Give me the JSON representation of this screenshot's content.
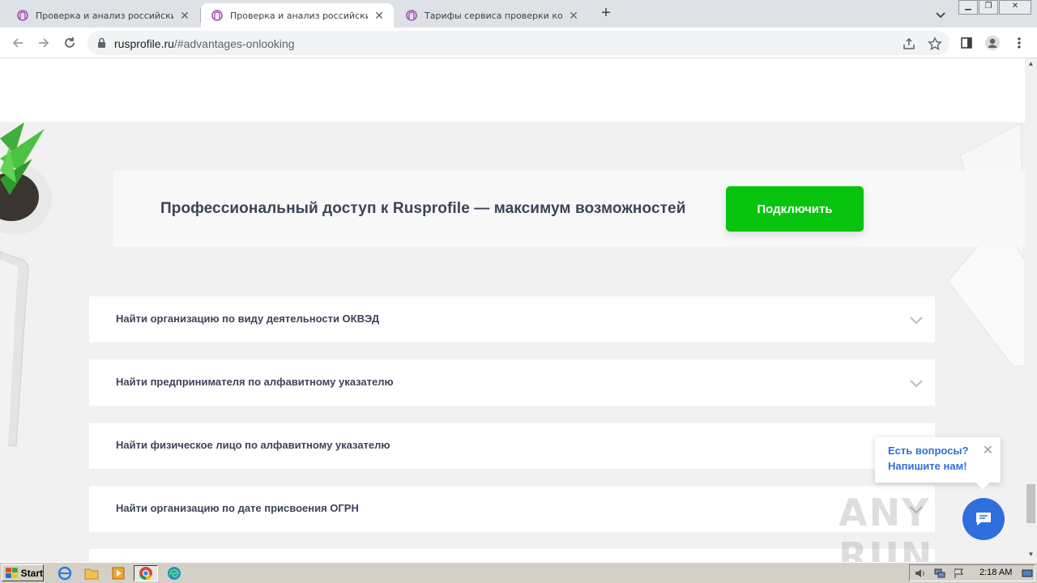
{
  "browser": {
    "tabs": [
      {
        "title": "Проверка и анализ российских юр",
        "active": false
      },
      {
        "title": "Проверка и анализ российских юр",
        "active": true
      },
      {
        "title": "Тарифы сервиса проверки контра",
        "active": false
      }
    ],
    "new_tab_label": "+",
    "address": {
      "host": "rusprofile.ru",
      "path": "/#advantages-onlooking"
    }
  },
  "page": {
    "promo_text": "Профессиональный доступ к Rusprofile — максимум возможностей",
    "connect_label": "Подключить",
    "accordion": [
      {
        "label": "Найти организацию по виду деятельности ОКВЭД"
      },
      {
        "label": "Найти предпринимателя по алфавитному указателю"
      },
      {
        "label": "Найти физическое лицо по алфавитному указателю"
      },
      {
        "label": "Найти организацию по дате присвоения ОГРН"
      }
    ]
  },
  "chat": {
    "line1": "Есть вопросы?",
    "line2": "Напишите нам!",
    "close": "✕"
  },
  "watermark": "ANY RUN",
  "taskbar": {
    "start_label": "Start",
    "clock": "2:18 AM"
  },
  "colors": {
    "accent_green": "#09c40f",
    "chat_blue": "#2e6fde",
    "text_dark": "#3d4358"
  }
}
